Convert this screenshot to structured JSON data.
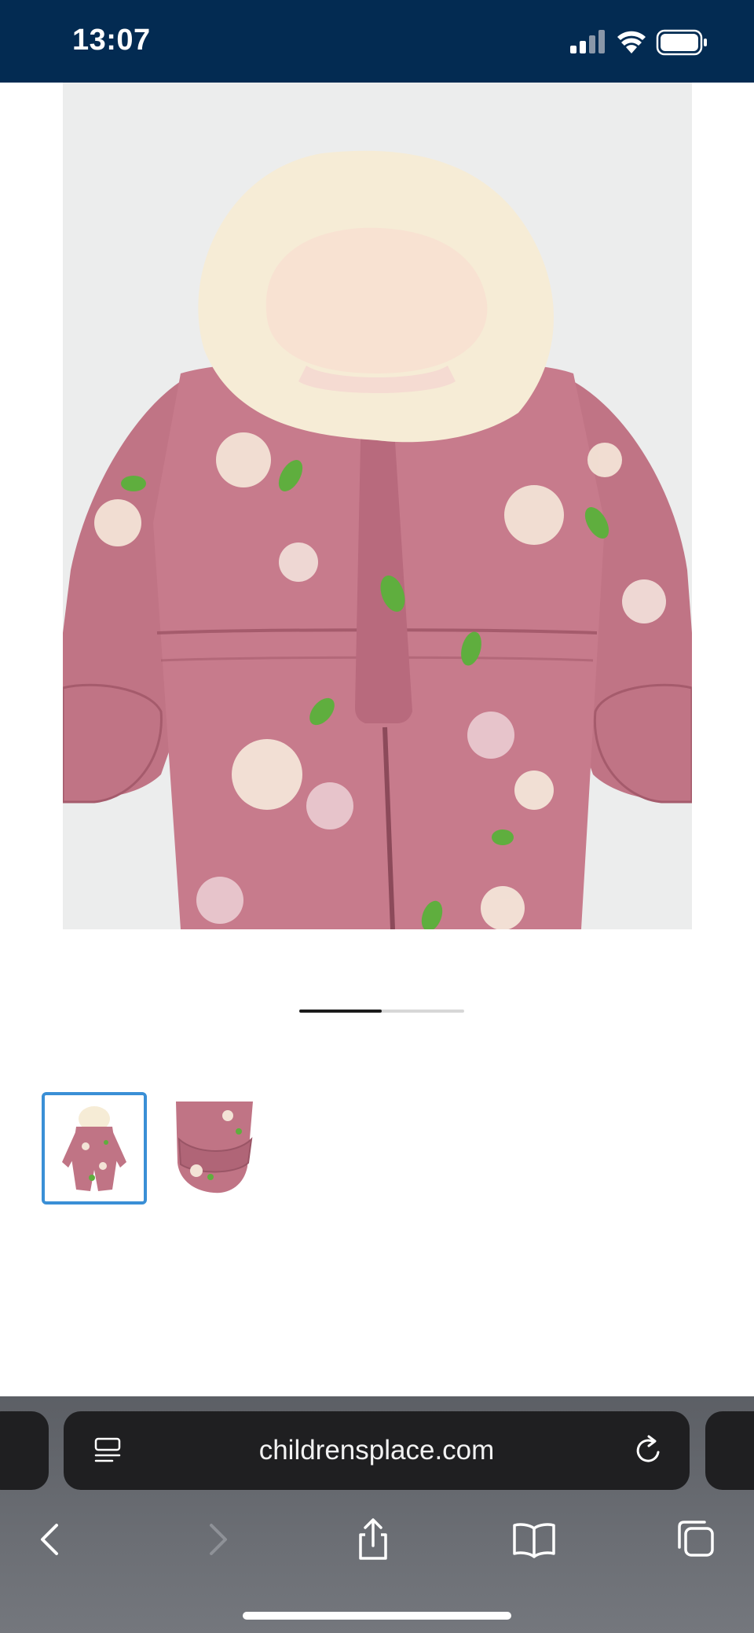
{
  "status_bar": {
    "time": "13:07",
    "icons": [
      "signal-icon",
      "wifi-icon",
      "battery-icon"
    ]
  },
  "product": {
    "main_image": "snowsuit-front-image",
    "carousel": {
      "current": 1,
      "total": 2,
      "progress": 0.5
    },
    "thumbnails": [
      {
        "name": "snowsuit-full-thumbnail",
        "selected": true
      },
      {
        "name": "snowsuit-mitten-thumbnail",
        "selected": false
      }
    ]
  },
  "browser": {
    "url": "childrensplace.com",
    "toolbar": [
      "back-icon",
      "forward-icon",
      "share-icon",
      "bookmarks-icon",
      "tabs-icon"
    ]
  },
  "colors": {
    "status_bar_bg": "#032b52",
    "thumb_selected_border": "#3a8fd6",
    "suit_pink": "#c07485",
    "fur_cream": "#f6ecd6"
  }
}
